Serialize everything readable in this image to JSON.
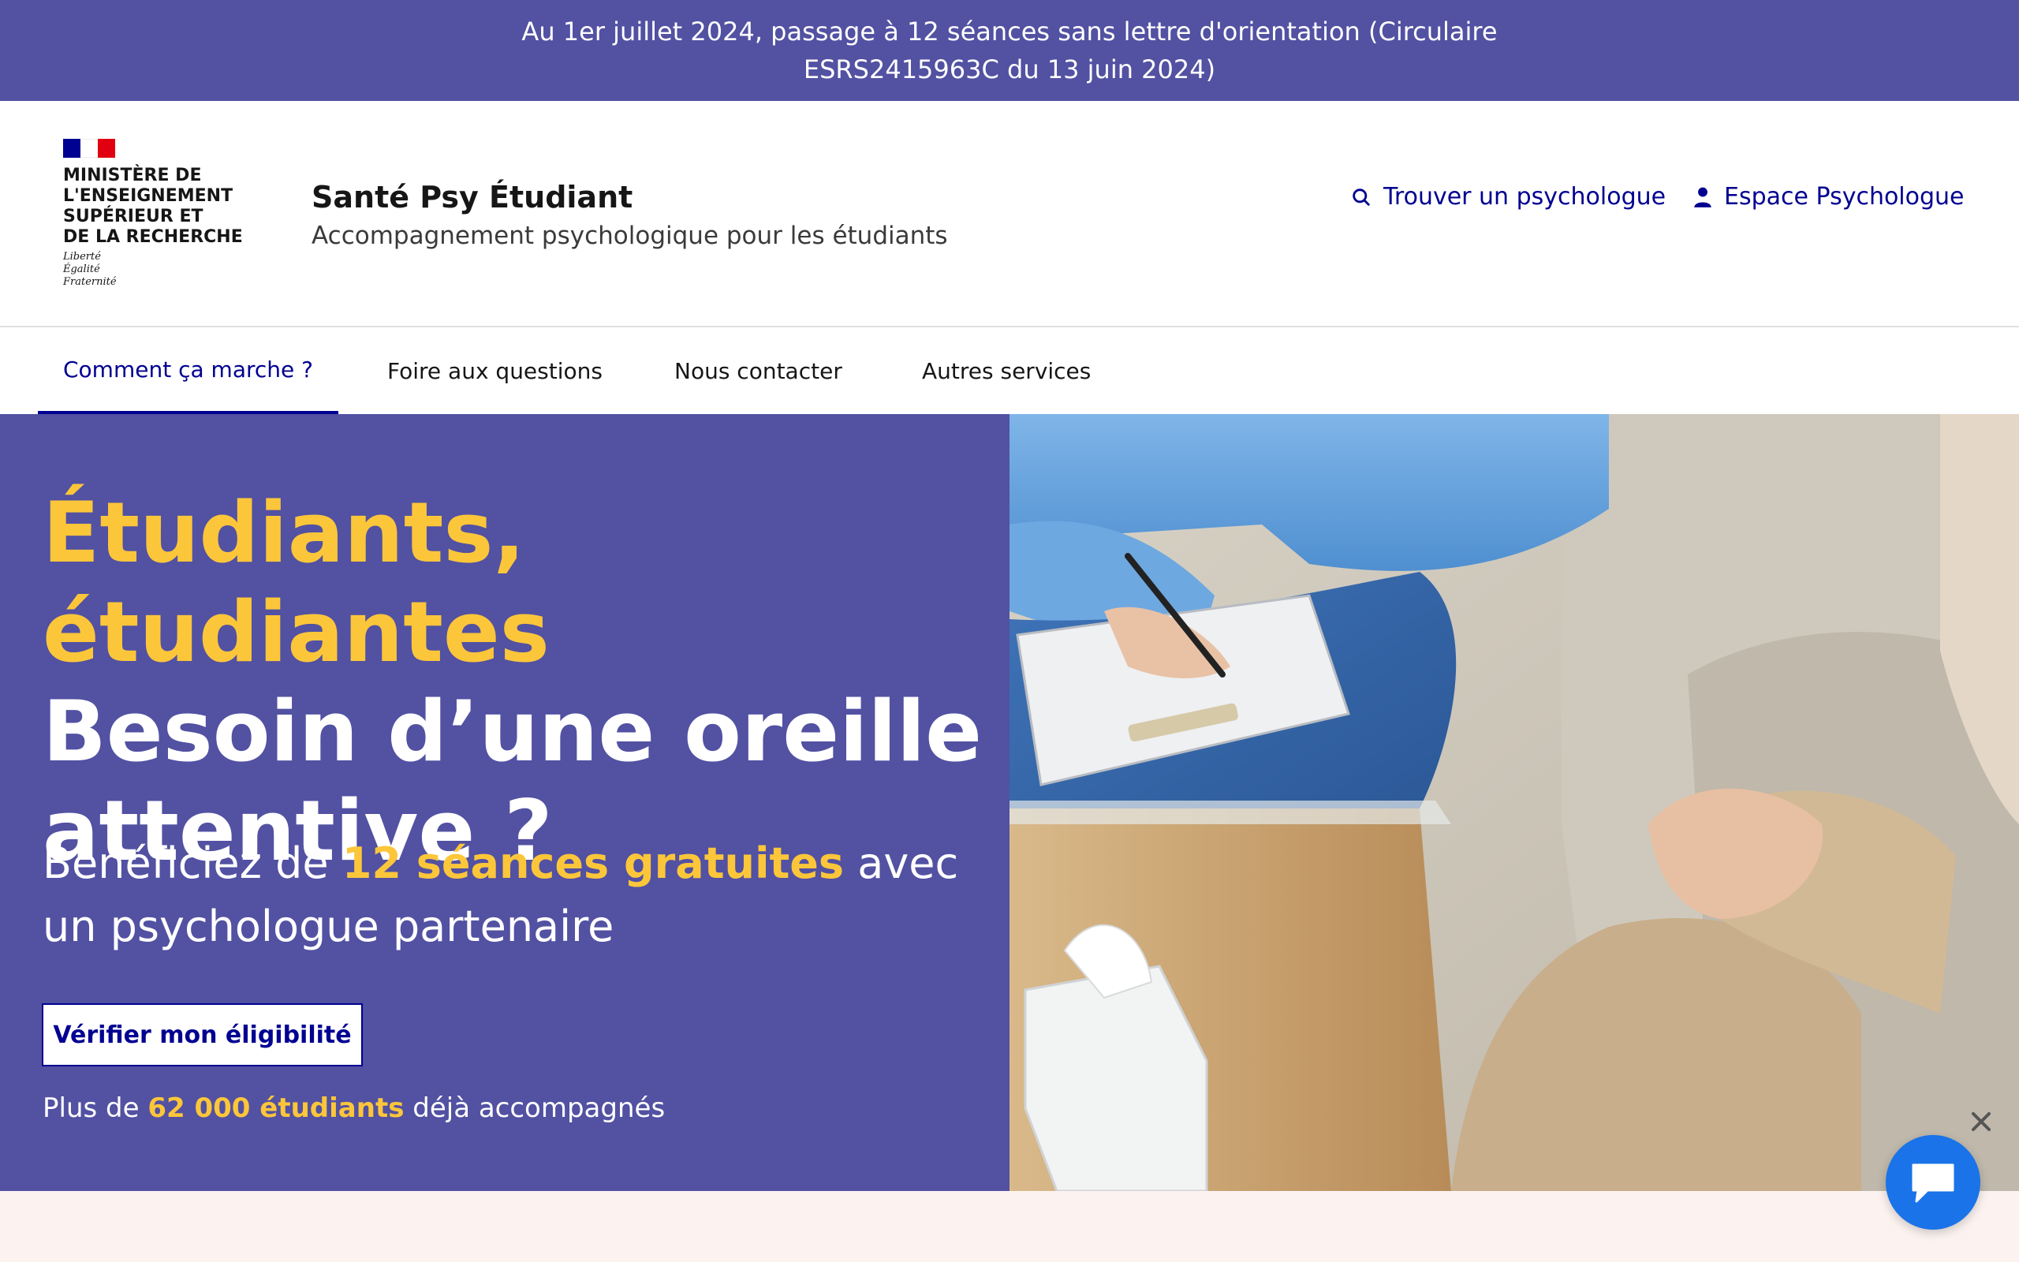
{
  "banner": {
    "line1": "Au 1er juillet 2024, passage à 12 séances sans lettre d'orientation (Circulaire",
    "line2": "ESRS2415963C du 13 juin 2024)"
  },
  "logo": {
    "ministry_lines": [
      "MINISTÈRE DE",
      "L'ENSEIGNEMENT",
      "SUPÉRIEUR ET",
      "DE LA RECHERCHE"
    ],
    "motto_lines": [
      "Liberté",
      "Égalité",
      "Fraternité"
    ]
  },
  "site": {
    "title": "Santé Psy Étudiant",
    "tagline": "Accompagnement psychologique pour les étudiants"
  },
  "quick_access": {
    "find": "Trouver un psychologue",
    "space": "Espace Psychologue"
  },
  "nav": {
    "items": [
      "Comment ça marche ?",
      "Foire aux questions",
      "Nous contacter",
      "Autres services"
    ],
    "active": "Comment ça marche ?"
  },
  "hero": {
    "title_line1": "Étudiants, étudiantes",
    "title_line2": "Besoin d’une oreille",
    "title_line3": "attentive ?",
    "lead_prefix": "Bénéficiez de ",
    "lead_highlight": "12 séances gratuites",
    "lead_suffix": " avec un psychologue partenaire",
    "cta": "Vérifier mon éligibilité",
    "stats_prefix": "Plus de ",
    "stats_highlight": "62 000 étudiants",
    "stats_suffix": " déjà accompagnés"
  },
  "colors": {
    "brand_purple": "#5251a2",
    "accent_yellow": "#fcc63a",
    "link_blue": "#000091",
    "chat_blue": "#1a73e8",
    "footer_band": "#fcf3f1"
  },
  "icons": {
    "find": "search-icon",
    "space": "user-icon",
    "close": "close-icon",
    "chat": "chat-bubble-icon"
  }
}
